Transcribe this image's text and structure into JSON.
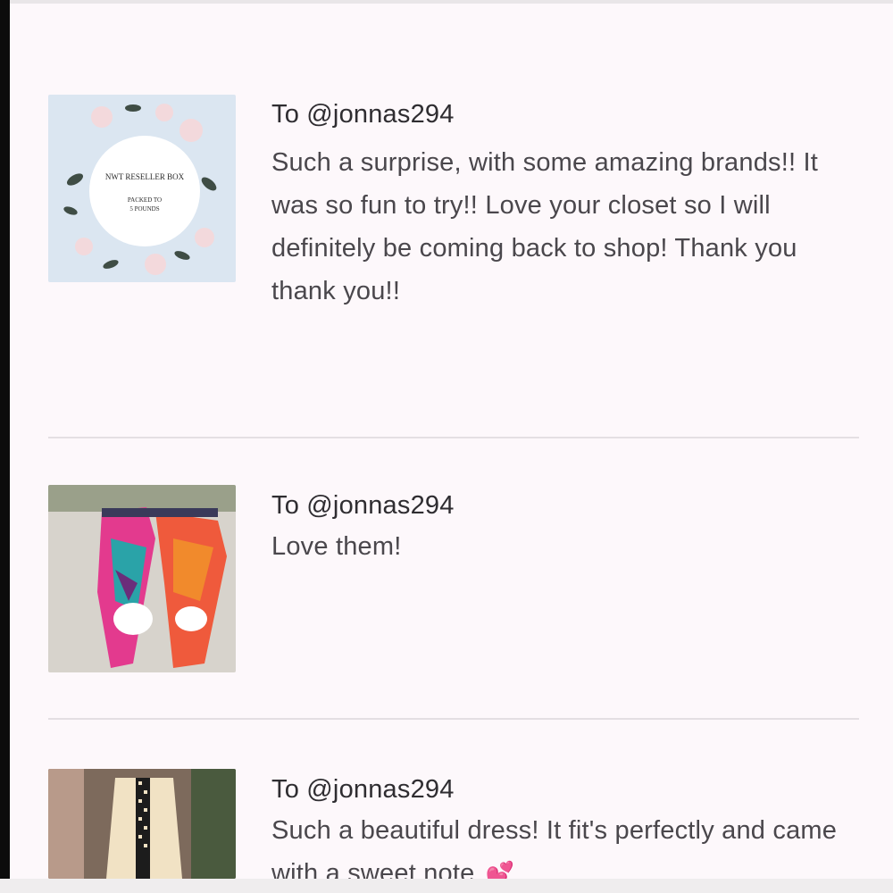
{
  "reviews": [
    {
      "recipient": "To @jonnas294",
      "message": "Such a surprise, with some amazing brands!! It was so fun to try!! Love your closet so I will definitely be coming back to shop! Thank you thank you!!",
      "thumbnail": {
        "label_line1": "NWT RESELLER BOX",
        "label_line2": "PACKED TO",
        "label_line3": "5 POUNDS"
      }
    },
    {
      "recipient": "To @jonnas294",
      "message": "Love them!"
    },
    {
      "recipient": "To @jonnas294",
      "message": "Such a beautiful dress! It fit's perfectly and came with a sweet note",
      "emoji_icon": "two-hearts-icon"
    }
  ],
  "colors": {
    "background": "#fdf8fb",
    "text": "#4a474c",
    "divider": "#e4dfe3",
    "heart": "#d6459c"
  }
}
